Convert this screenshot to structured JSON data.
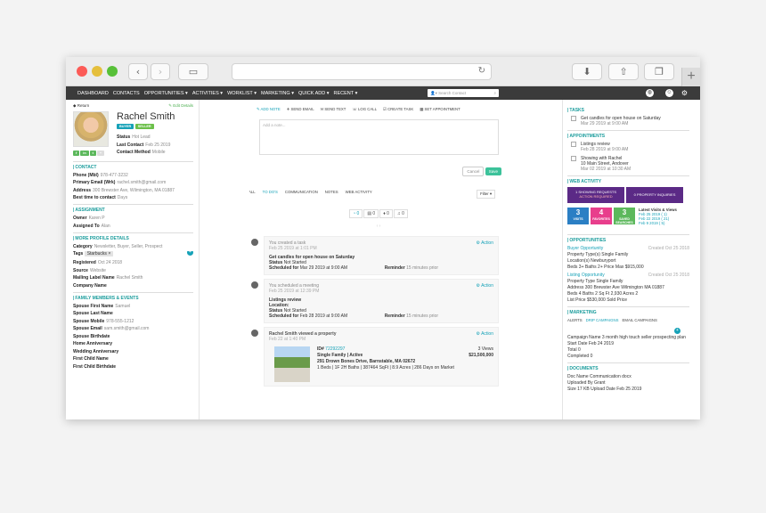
{
  "nav": {
    "items": [
      "DASHBOARD",
      "CONTACTS",
      "OPPORTUNITIES ▾",
      "ACTIVITIES ▾",
      "WORKLIST ▾",
      "MARKETING ▾",
      "QUICK ADD ▾",
      "RECENT ▾"
    ],
    "search_placeholder": "Search Contact"
  },
  "left": {
    "return": "Return",
    "edit": "Edit Details",
    "name": "Rachel Smith",
    "badges": [
      "BUYER",
      "SELLER"
    ],
    "status_l": "Status",
    "status_v": "Hot Lead",
    "lc_l": "Last Contact",
    "lc_v": "Feb 25 2019",
    "cm_l": "Contact Method",
    "cm_v": "Mobile",
    "contact": {
      "title": "CONTACT",
      "rows": [
        [
          "Phone (Mbl)",
          "978-477-3232"
        ],
        [
          "Primary Email (Wrk)",
          "rachel.smith@gmail.com"
        ],
        [
          "Address",
          "300 Brewster Ave, Wilmington, MA 01887"
        ],
        [
          "Best time to contact",
          "Days"
        ]
      ]
    },
    "assignment": {
      "title": "ASSIGNMENT",
      "rows": [
        [
          "Owner",
          "Karen P"
        ],
        [
          "Assigned To",
          "Alan"
        ]
      ]
    },
    "more": {
      "title": "MORE PROFILE DETAILS",
      "category_l": "Category",
      "category_v": "Newsletter, Buyer, Seller, Prospect",
      "tags_l": "Tags",
      "tag": "Starbucks",
      "rows": [
        [
          "Registered",
          "Oct 24 2018"
        ],
        [
          "Source",
          "Website"
        ],
        [
          "Mailing Label Name",
          "Rachel Smith"
        ],
        [
          "Company Name",
          ""
        ]
      ]
    },
    "family": {
      "title": "FAMILY MEMBERS & EVENTS",
      "rows": [
        [
          "Spouse First Name",
          "Samuel"
        ],
        [
          "Spouse Last Name",
          ""
        ],
        [
          "Spouse Mobile",
          "978-555-1212"
        ],
        [
          "Spouse Email",
          "sam.smith@gmail.com"
        ],
        [
          "Spouse Birthdate",
          ""
        ],
        [
          "Home Anniversary",
          ""
        ],
        [
          "Wedding Anniversary",
          ""
        ],
        [
          "First Child Name",
          ""
        ],
        [
          "First Child Birthdate",
          ""
        ]
      ]
    }
  },
  "mid": {
    "actions": [
      "ADD NOTE",
      "SEND EMAIL",
      "SEND TEXT",
      "LOG CALL",
      "CREATE TASK",
      "SET APPOINTMENT"
    ],
    "note_placeholder": "Add a note...",
    "cancel": "Cancel",
    "save": "Save",
    "tabs": [
      "ALL",
      "TO DO'S",
      "COMMUNICATION",
      "NOTES",
      "WEB ACTIVITY"
    ],
    "filter": "Filter",
    "counts": [
      "0",
      "0",
      "0",
      "0"
    ],
    "feed": [
      {
        "head": "You created a task",
        "date": "Feb 25 2019 at 1:01 PM",
        "action": "Action",
        "title": "Get candles for open house on Saturday",
        "l2": "Status",
        "v2": "Not Started",
        "l3": "Scheduled for",
        "v3": "Mar 29 2019 at 9:00 AM",
        "rl": "Reminder",
        "rv": "15 minutes prior"
      },
      {
        "head": "You scheduled a meeting",
        "date": "Feb 25 2019 at 12:39 PM",
        "action": "Action",
        "title": "Listings review",
        "l2": "Location:",
        "v2": "",
        "l4": "Status",
        "v4": "Not Started",
        "l3": "Scheduled for",
        "v3": "Feb 28 2019 at 9:00 AM",
        "rl": "Reminder",
        "rv": "15 minutes prior"
      }
    ],
    "prop": {
      "head": "Rachel Smith viewed a property",
      "date": "Feb 22 at 1:40 PM",
      "action": "Action",
      "id_l": "ID#",
      "id": "72292297",
      "type": "Single Family | Active",
      "addr": "291 Drown Bones Drive, Barnstable, MA 02672",
      "details": "1 Beds | 1F 2H Baths | 387464 SqFt | 8.9 Acres | 286 Days on Market",
      "views": "3 Views",
      "price": "$21,500,000"
    }
  },
  "right": {
    "tasks_title": "TASKS",
    "task": "Get candles for open house on Saturday",
    "task_date": "Mar 29 2019 at 9:00 AM",
    "appt_title": "APPOINTMENTS",
    "appts": [
      [
        "Listings review",
        "Feb 28 2019 at 9:00 AM"
      ],
      [
        "Showing with Rachel",
        "10 Main Street, Andover",
        "Mar 02 2019 at 10:30 AM"
      ]
    ],
    "web_title": "WEB ACTIVITY",
    "req": "1 SHOWING REQUESTS",
    "req_sub": "ACTION REQUIRED",
    "inq": "0 PROPERTY INQUIRIES",
    "tiles": [
      [
        "3",
        "VISITS"
      ],
      [
        "4",
        "FAVORITES"
      ],
      [
        "3",
        "SAVED SEARCHES"
      ]
    ],
    "latest": "Latest Visits & Views",
    "visits": [
      "Feb 25 2019 ( 1)",
      "Feb 22 2019 ( 21)",
      "Feb 9 2019 ( 5)"
    ],
    "opp_title": "OPPORTUNITIES",
    "opp1": {
      "name": "Buyer Opportunity",
      "created": "Created Oct 25 2018",
      "rows": [
        "Property Type(s)  Single Family",
        "Location(s)  Newburyport",
        "Beds  3+     Baths  2+     Price Max  $915,000"
      ]
    },
    "opp2": {
      "name": "Listing Opportunity",
      "created": "Created Oct 25 2018",
      "rows": [
        "Property Type  Single Family",
        "Address  300 Brewster Ave Wilmington MA 01887",
        "Beds  4    Baths  2    Sq Ft  2,930    Acres  2",
        "List Price  $530,000    Sold Price"
      ]
    },
    "mkt_title": "MARKETING",
    "mkt_tabs": [
      "ALERTS",
      "DRIP CAMPAIGNS",
      "EMAIL CAMPAIGNS"
    ],
    "camp": [
      "Campaign Name  3 month high touch seller prospecting plan",
      "Start Date  Feb 24 2019",
      "Total  0",
      "Completed  0"
    ],
    "docs_title": "DOCUMENTS",
    "docs": [
      "Doc Name  Communication docx",
      "Uploaded By  Grant",
      "Size  17 KB     Upload Date  Feb 25 2019"
    ]
  }
}
